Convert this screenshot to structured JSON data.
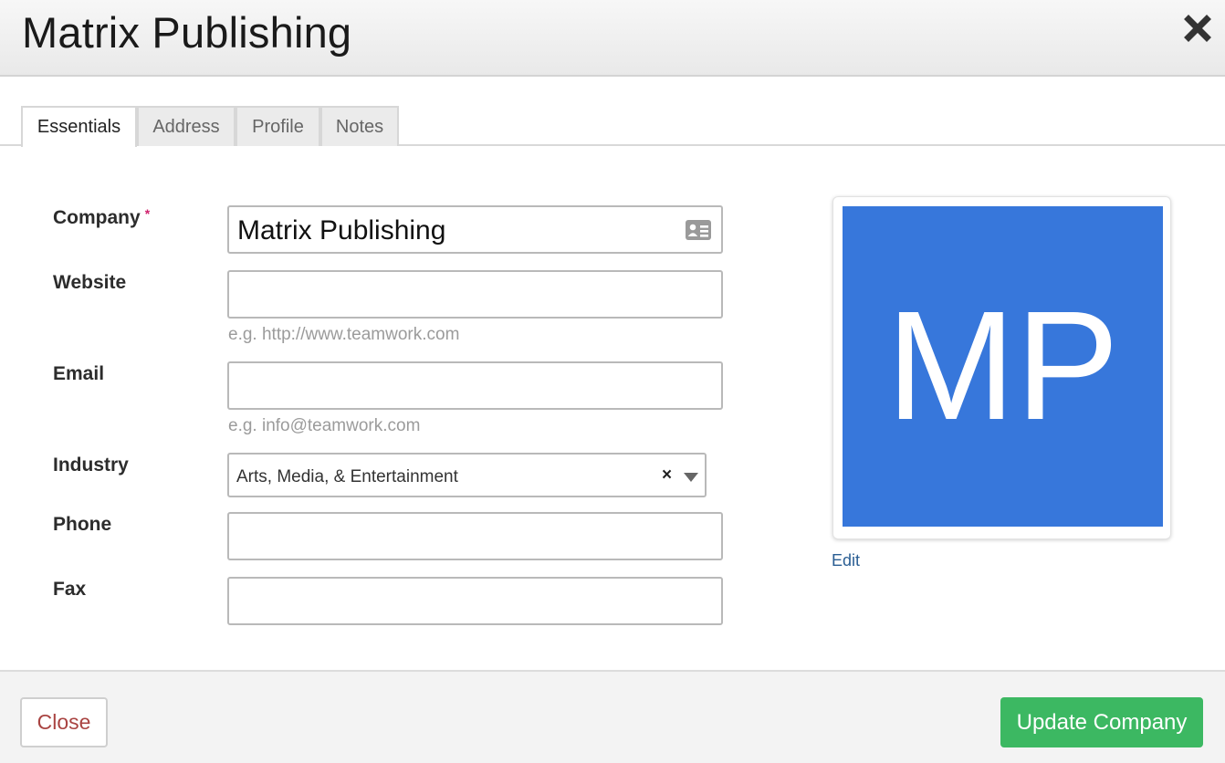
{
  "header": {
    "title": "Matrix Publishing",
    "close_icon": "close-icon"
  },
  "tabs": [
    {
      "label": "Essentials",
      "active": true
    },
    {
      "label": "Address",
      "active": false
    },
    {
      "label": "Profile",
      "active": false
    },
    {
      "label": "Notes",
      "active": false
    }
  ],
  "form": {
    "company": {
      "label": "Company",
      "required_marker": "*",
      "value": "Matrix Publishing",
      "icon": "contact-card-icon"
    },
    "website": {
      "label": "Website",
      "value": "",
      "hint": "e.g. http://www.teamwork.com"
    },
    "email": {
      "label": "Email",
      "value": "",
      "hint": "e.g. info@teamwork.com"
    },
    "industry": {
      "label": "Industry",
      "value": "Arts, Media, & Entertainment",
      "clear_glyph": "×"
    },
    "phone": {
      "label": "Phone",
      "value": ""
    },
    "fax": {
      "label": "Fax",
      "value": ""
    }
  },
  "avatar": {
    "initials": "MP",
    "color": "#3777db",
    "edit_label": "Edit"
  },
  "footer": {
    "close_label": "Close",
    "update_label": "Update Company",
    "update_color": "#3cb862"
  }
}
